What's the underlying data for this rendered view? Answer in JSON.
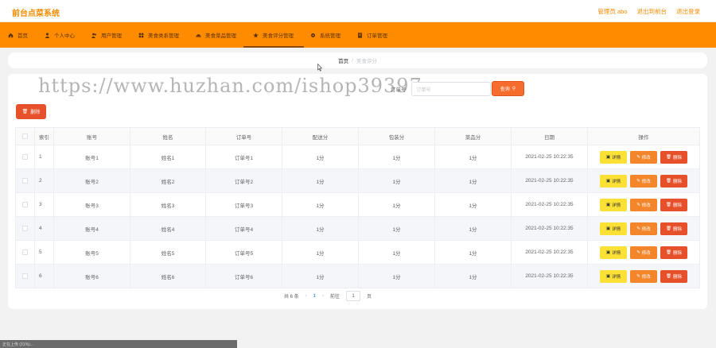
{
  "app": {
    "title": "前台点菜系统"
  },
  "top_links": [
    "管理员 abo",
    "退出到前台",
    "退出登录"
  ],
  "nav": [
    {
      "label": "首页",
      "icon": "home-icon"
    },
    {
      "label": "个人中心",
      "icon": "user-icon"
    },
    {
      "label": "用户管理",
      "icon": "users-icon"
    },
    {
      "label": "美食类系管理",
      "icon": "category-icon"
    },
    {
      "label": "美食菜品管理",
      "icon": "dish-icon"
    },
    {
      "label": "美食评分管理",
      "icon": "star-icon"
    },
    {
      "label": "系统管理",
      "icon": "settings-icon"
    },
    {
      "label": "订单管理",
      "icon": "order-icon"
    }
  ],
  "breadcrumb": {
    "home": "首页",
    "current": "美食评分"
  },
  "watermark": "https://www.huzhan.com/ishop39397",
  "search": {
    "label": "订单号",
    "placeholder": "订单号",
    "button": "查询"
  },
  "toolbar": {
    "delete_label": "删除"
  },
  "table": {
    "headers": [
      "索引",
      "账号",
      "姓名",
      "订单号",
      "配送分",
      "包装分",
      "菜品分",
      "日期",
      "操作"
    ],
    "rows": [
      [
        "1",
        "账号1",
        "姓名1",
        "订单号1",
        "1分",
        "1分",
        "1分",
        "2021-02-25 10:22:35"
      ],
      [
        "2",
        "账号2",
        "姓名2",
        "订单号2",
        "1分",
        "1分",
        "1分",
        "2021-02-25 10:22:35"
      ],
      [
        "3",
        "账号3",
        "姓名3",
        "订单号3",
        "1分",
        "1分",
        "1分",
        "2021-02-25 10:22:35"
      ],
      [
        "4",
        "账号4",
        "姓名4",
        "订单号4",
        "1分",
        "1分",
        "1分",
        "2021-02-25 10:22:35"
      ],
      [
        "5",
        "账号5",
        "姓名5",
        "订单号5",
        "1分",
        "1分",
        "1分",
        "2021-02-25 10:22:35"
      ],
      [
        "6",
        "账号6",
        "姓名6",
        "订单号6",
        "1分",
        "1分",
        "1分",
        "2021-02-25 10:22:35"
      ]
    ],
    "actions": {
      "detail": "详情",
      "edit": "修改",
      "delete": "删除"
    }
  },
  "pagination": {
    "total": "共 6 条",
    "current": "1",
    "goto": "前往",
    "page_input": "1",
    "page_unit": "页"
  },
  "status_bar": "正在上传 (31%)...",
  "colors": {
    "accent": "#ff8c00",
    "danger": "#e6512b",
    "warning": "#fbe136"
  }
}
